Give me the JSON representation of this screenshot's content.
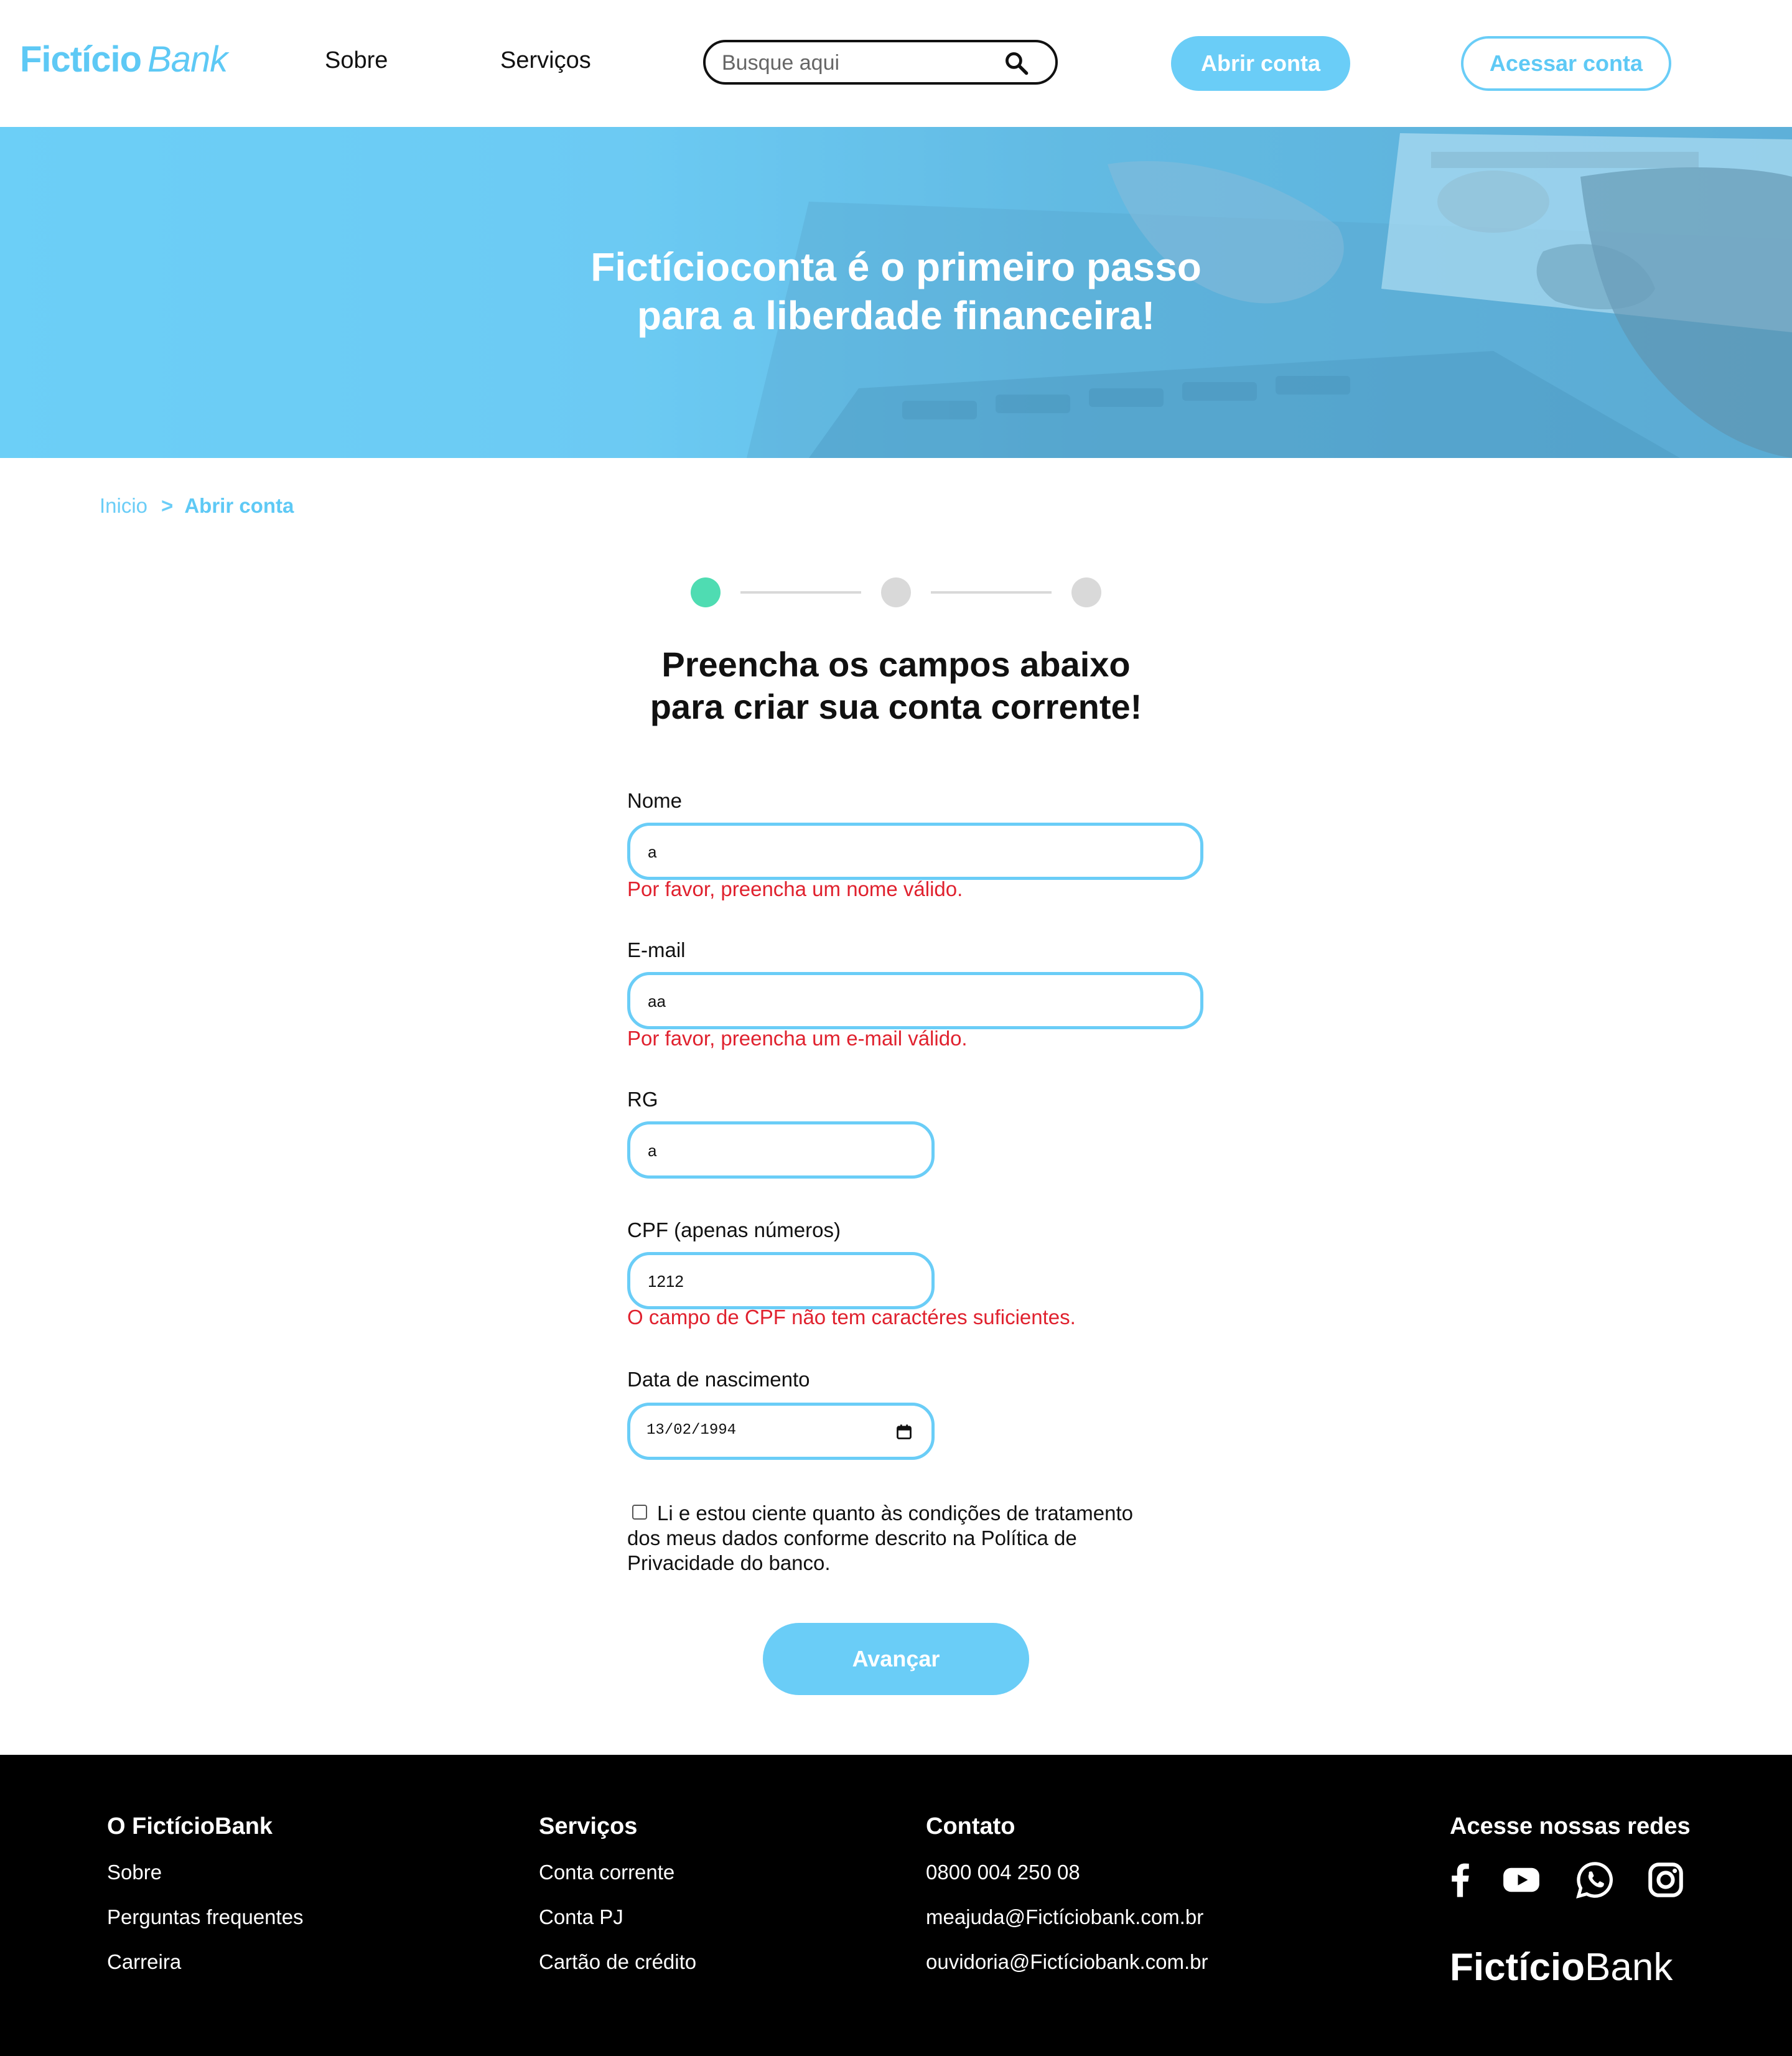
{
  "brand": {
    "name_bold": "Fictício",
    "name_italic": "Bank",
    "color": "#5ec9f5"
  },
  "header": {
    "nav": [
      "Sobre",
      "Serviços"
    ],
    "search": {
      "placeholder": "Busque aqui",
      "icon": "search-icon"
    },
    "open_account_label": "Abrir conta",
    "access_account_label": "Acessar conta"
  },
  "hero": {
    "title_line1": "Fictícioconta é o primeiro passo",
    "title_line2": "para a liberdade financeira!"
  },
  "breadcrumb": {
    "home": "Inicio",
    "separator": ">",
    "current": "Abrir conta"
  },
  "stepper": {
    "steps": 3,
    "current": 1,
    "active_color": "#4fdcb2",
    "inactive_color": "#d9d9d9"
  },
  "form": {
    "title_line1": "Preencha os campos abaixo",
    "title_line2": "para criar sua conta corrente!",
    "name": {
      "label": "Nome",
      "value": "a",
      "error": "Por favor, preencha um nome válido."
    },
    "email": {
      "label": "E-mail",
      "value": "aa",
      "error": "Por favor, preencha um e-mail válido."
    },
    "rg": {
      "label": "RG",
      "value": "a"
    },
    "cpf": {
      "label": "CPF (apenas números)",
      "value": "1212",
      "error": "O campo de CPF não tem caractéres suficientes."
    },
    "birth": {
      "label": "Data de nascimento",
      "value": "13/02/1994",
      "icon": "calendar-icon"
    },
    "consent": {
      "checked": false,
      "text": "Li e estou ciente quanto às condições de tratamento dos meus dados conforme descrito na Política de Privacidade do banco."
    },
    "submit_label": "Avançar",
    "error_color": "#e0212e",
    "accent_color": "#6acdf7"
  },
  "footer": {
    "col1": {
      "title": "O FictícioBank",
      "links": [
        "Sobre",
        "Perguntas frequentes",
        "Carreira"
      ]
    },
    "col2": {
      "title": "Serviços",
      "links": [
        "Conta corrente",
        "Conta PJ",
        "Cartão de crédito"
      ]
    },
    "col3": {
      "title": "Contato",
      "links": [
        "0800 004 250 08",
        "meajuda@Fictíciobank.com.br",
        "ouvidoria@Fictíciobank.com.br"
      ]
    },
    "social": {
      "title": "Acesse nossas redes",
      "icons": [
        "facebook-icon",
        "youtube-icon",
        "whatsapp-icon",
        "instagram-icon"
      ]
    },
    "logo": {
      "bold": "Fictício",
      "regular": "Bank"
    }
  }
}
